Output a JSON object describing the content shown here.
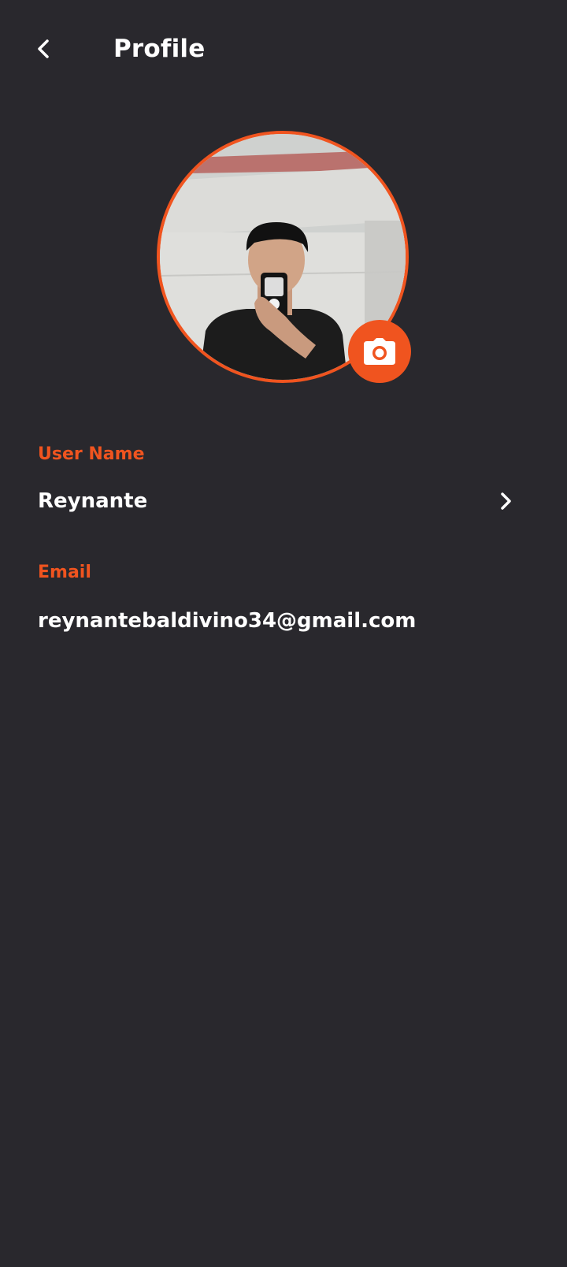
{
  "header": {
    "title": "Profile",
    "back_icon": "chevron-left-icon"
  },
  "profile": {
    "camera_icon": "camera-icon",
    "accent_color": "#f0541f",
    "background_color": "#29282d"
  },
  "fields": {
    "username": {
      "label": "User Name",
      "value": "Reynante",
      "action_icon": "chevron-right-icon"
    },
    "email": {
      "label": "Email",
      "value": "reynantebaldivino34@gmail.com"
    }
  }
}
